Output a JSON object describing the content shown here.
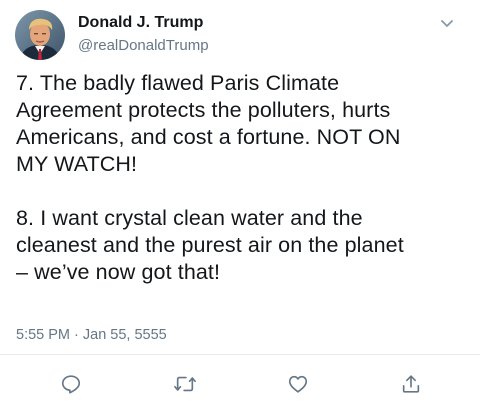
{
  "author": {
    "display_name": "Donald J. Trump",
    "handle": "@realDonaldTrump"
  },
  "tweet": {
    "text": "7. The badly flawed Paris Climate\nAgreement protects the polluters, hurts\nAmericans, and cost a fortune. NOT ON\nMY WATCH!\n\n 8. I want crystal clean water and the\ncleanest and the purest air on the planet\n– we’ve now got that!",
    "timestamp": "5:55 PM · Jan 55, 5555"
  },
  "actions": [
    {
      "icon": "reply-icon"
    },
    {
      "icon": "retweet-icon"
    },
    {
      "icon": "like-icon"
    },
    {
      "icon": "share-icon"
    }
  ],
  "colors": {
    "text": "#14171a",
    "secondary": "#657786",
    "divider": "#e6ecf0"
  }
}
